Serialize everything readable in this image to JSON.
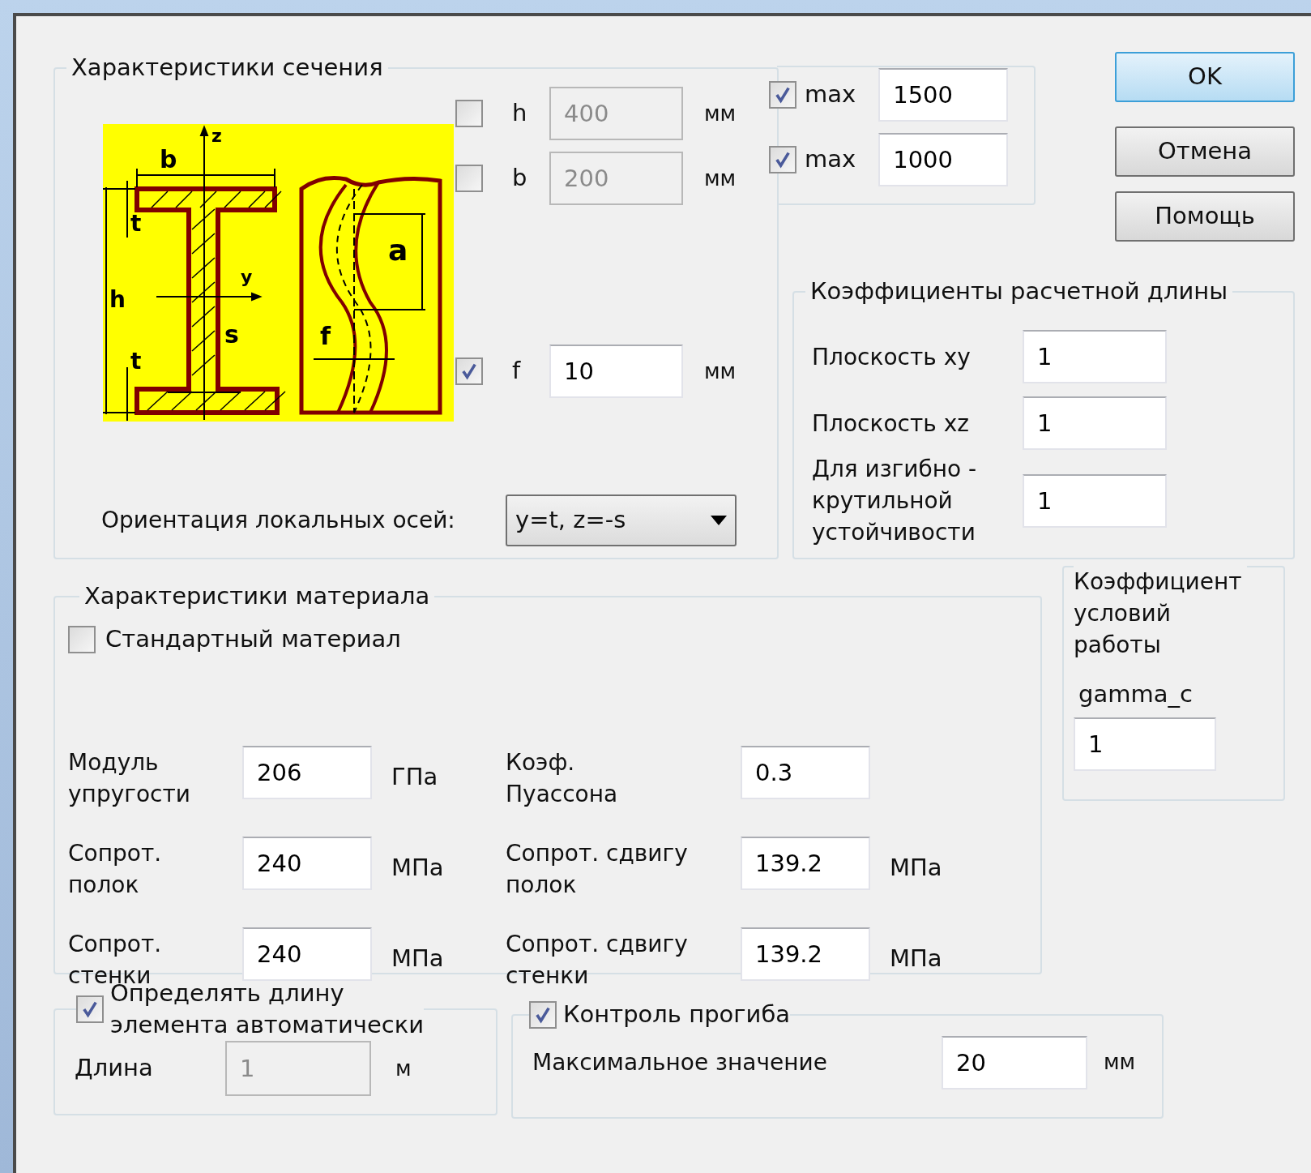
{
  "section": {
    "title": "Характеристики сечения",
    "diagram_labels": [
      {
        "kind": "z",
        "text": "z"
      },
      {
        "kind": "b",
        "text": "b"
      },
      {
        "kind": "t_top",
        "text": "t"
      },
      {
        "kind": "y",
        "text": "y"
      },
      {
        "kind": "h",
        "text": "h"
      },
      {
        "kind": "s",
        "text": "s"
      },
      {
        "kind": "t_bottom",
        "text": "t"
      },
      {
        "kind": "a",
        "text": "a"
      },
      {
        "kind": "f",
        "text": "f"
      }
    ],
    "params": [
      {
        "checked": false,
        "label": "h",
        "value": "400",
        "disabled": true,
        "unit": "мм",
        "max": {
          "checked": true,
          "label": "max",
          "value": "1500"
        }
      },
      {
        "checked": false,
        "label": "b",
        "value": "200",
        "disabled": true,
        "unit": "мм",
        "max": {
          "checked": true,
          "label": "max",
          "value": "1000"
        }
      },
      {
        "checked": true,
        "label": "f",
        "value": "10",
        "disabled": false,
        "unit": "мм"
      }
    ],
    "orientation": {
      "label": "Ориентация локальных осей:",
      "value": "y=t, z=-s"
    }
  },
  "buttons": [
    {
      "label": "OK",
      "default": true
    },
    {
      "label": "Отмена",
      "default": false
    },
    {
      "label": "Помощь",
      "default": false
    }
  ],
  "length_coefficients": {
    "title": "Коэффициенты расчетной длины",
    "rows": [
      {
        "label": "Плоскость xy",
        "value": "1"
      },
      {
        "label": "Плоскость xz",
        "value": "1"
      },
      {
        "label": "Для изгибно -\nкрутильной\nустойчивости",
        "value": "1"
      }
    ]
  },
  "material": {
    "title": "Характеристики материала",
    "standard": {
      "label": "Стандартный материал",
      "checked": false
    },
    "rows": [
      {
        "left": {
          "label": "Модуль\nупругости",
          "value": "206",
          "unit": "ГПа"
        },
        "right": {
          "label": "Коэф.\nПуассона",
          "value": "0.3"
        }
      },
      {
        "left": {
          "label": "Сопрот.\nполок",
          "value": "240",
          "unit": "МПа"
        },
        "right": {
          "label": "Сопрот. сдвигу\nполок",
          "value": "139.2",
          "unit": "МПа"
        }
      },
      {
        "left": {
          "label": "Сопрот.\nстенки",
          "value": "240",
          "unit": "МПа"
        },
        "right": {
          "label": "Сопрот. сдвигу\nстенки",
          "value": "139.2",
          "unit": "МПа"
        }
      }
    ]
  },
  "gamma": {
    "title": "Коэффициент\nусловий\nработы",
    "label": "gamma_c",
    "value": "1"
  },
  "auto_length": {
    "label": "Определять длину\nэлемента автоматически",
    "checked": true,
    "field_label": "Длина",
    "value": "1",
    "disabled": true,
    "unit": "м"
  },
  "deflection": {
    "label": "Контроль прогиба",
    "checked": true,
    "field_label": "Максимальное значение",
    "value": "20",
    "unit": "мм"
  }
}
